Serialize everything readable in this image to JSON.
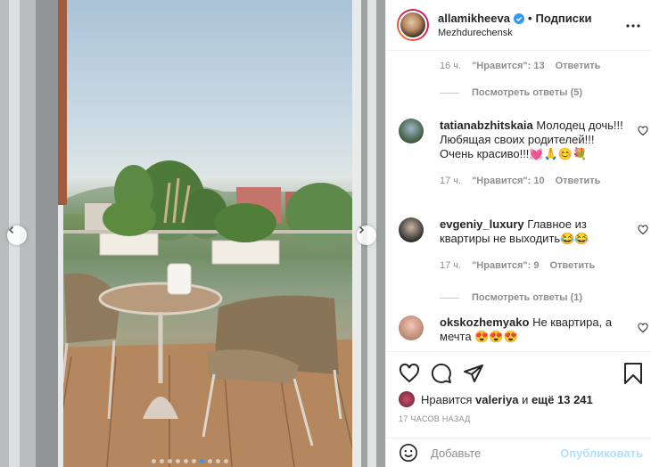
{
  "header": {
    "username": "allamikheeva",
    "separator": "•",
    "follow_label": "Подписки",
    "location": "Mezhdurechensk",
    "more_icon": "more-horizontal-icon"
  },
  "photo": {
    "carousel_count": 10,
    "carousel_active_index": 6
  },
  "comments": {
    "prev_meta": {
      "time": "16 ч.",
      "likes": "\"Нравится\": 13",
      "reply": "Ответить"
    },
    "prev_replies": "Посмотреть ответы (5)",
    "items": [
      {
        "user": "tatianabzhitskaia",
        "text": "Молодец дочь!!! Любящая своих родителей!!! Очень красиво!!!💓🙏😊💐",
        "time": "17 ч.",
        "likes": "\"Нравится\": 10",
        "reply": "Ответить"
      },
      {
        "user": "evgeniy_luxury",
        "text": "Главное из квартиры не выходить😂😂",
        "time": "17 ч.",
        "likes": "\"Нравится\": 9",
        "reply": "Ответить",
        "replies": "Посмотреть ответы (1)"
      },
      {
        "user": "okskozhemyako",
        "text": "Не квартира, а мечта 😍😍😍"
      }
    ]
  },
  "actions": {
    "liked_prefix": "Нравится",
    "liked_user": "valeriya",
    "liked_connector": "и",
    "liked_count": "ещё 13 241",
    "timestamp": "17 ЧАСОВ НАЗАД"
  },
  "add_comment": {
    "placeholder": "Добавьте",
    "publish_label": "Опубликовать"
  },
  "colors": {
    "accent": "#3897f0",
    "publish_disabled": "#b2dffc",
    "muted": "#8e8e8e"
  }
}
